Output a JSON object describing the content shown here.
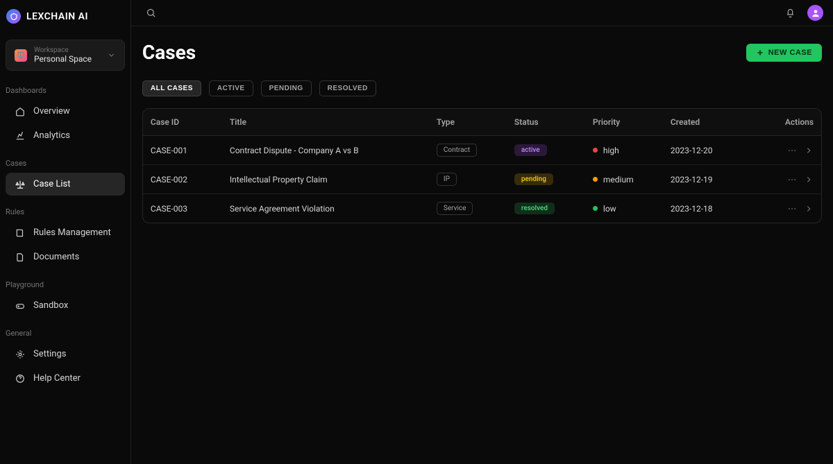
{
  "brand": "LEXCHAIN AI",
  "workspace": {
    "label": "Workspace",
    "name": "Personal Space",
    "emoji": "⚖️"
  },
  "sections": {
    "dashboards": {
      "label": "Dashboards",
      "items": [
        {
          "label": "Overview"
        },
        {
          "label": "Analytics"
        }
      ]
    },
    "cases": {
      "label": "Cases",
      "items": [
        {
          "label": "Case List"
        }
      ]
    },
    "rules": {
      "label": "Rules",
      "items": [
        {
          "label": "Rules Management"
        },
        {
          "label": "Documents"
        }
      ]
    },
    "playground": {
      "label": "Playground",
      "items": [
        {
          "label": "Sandbox"
        }
      ]
    },
    "general": {
      "label": "General",
      "items": [
        {
          "label": "Settings"
        },
        {
          "label": "Help Center"
        }
      ]
    }
  },
  "page": {
    "title": "Cases",
    "new_case_label": "NEW CASE"
  },
  "filters": [
    {
      "label": "ALL CASES"
    },
    {
      "label": "ACTIVE"
    },
    {
      "label": "PENDING"
    },
    {
      "label": "RESOLVED"
    }
  ],
  "columns": {
    "id": "Case ID",
    "title": "Title",
    "type": "Type",
    "status": "Status",
    "priority": "Priority",
    "created": "Created",
    "actions": "Actions"
  },
  "rows": [
    {
      "id": "CASE-001",
      "title": "Contract Dispute - Company A vs B",
      "type": "Contract",
      "status": "active",
      "priority": "high",
      "created": "2023-12-20"
    },
    {
      "id": "CASE-002",
      "title": "Intellectual Property Claim",
      "type": "IP",
      "status": "pending",
      "priority": "medium",
      "created": "2023-12-19"
    },
    {
      "id": "CASE-003",
      "title": "Service Agreement Violation",
      "type": "Service",
      "status": "resolved",
      "priority": "low",
      "created": "2023-12-18"
    }
  ]
}
